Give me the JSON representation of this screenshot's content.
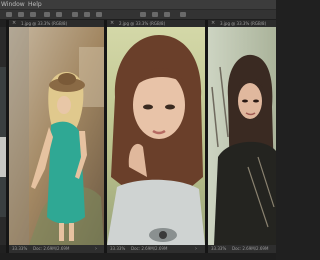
{
  "menubar": {
    "window": "Window",
    "help": "Help"
  },
  "documents": [
    {
      "tab": "1.jpg @ 33.3% (RGB/8)",
      "zoom": "33.33%",
      "doc": "Doc: 2.69M/2.69M"
    },
    {
      "tab": "2.jpg @ 33.3% (RGB/8)",
      "zoom": "33.33%",
      "doc": "Doc: 2.69M/2.69M"
    },
    {
      "tab": "3.jpg @ 33.3% (RGB/8)",
      "zoom": "33.33%",
      "doc": "Doc: 2.69M/2.69M"
    }
  ],
  "icons": {
    "close": "close-icon",
    "arrow": "arrow-right-icon"
  }
}
